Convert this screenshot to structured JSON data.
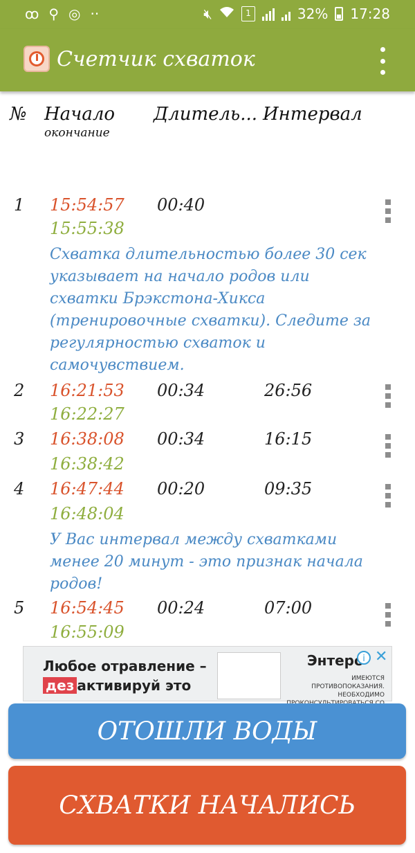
{
  "status_bar": {
    "time": "17:28",
    "battery": "32%",
    "sim": "1"
  },
  "app": {
    "title": "Счетчик схваток"
  },
  "table": {
    "headers": {
      "num": "№",
      "start": "Начало",
      "end": "окончание",
      "duration": "Длитель...",
      "interval": "Интервал"
    },
    "rows": [
      {
        "num": "1",
        "start": "15:54:57",
        "end": "15:55:38",
        "duration": "00:40",
        "interval": "",
        "note": "Схватка длительностью более 30 сек указывает на начало родов или схватки Брэкстона-Хикса (тренировочные схватки). Следите за регулярностью схваток и самочувствием."
      },
      {
        "num": "2",
        "start": "16:21:53",
        "end": "16:22:27",
        "duration": "00:34",
        "interval": "26:56",
        "note": ""
      },
      {
        "num": "3",
        "start": "16:38:08",
        "end": "16:38:42",
        "duration": "00:34",
        "interval": "16:15",
        "note": ""
      },
      {
        "num": "4",
        "start": "16:47:44",
        "end": "16:48:04",
        "duration": "00:20",
        "interval": "09:35",
        "note": "У Вас интервал между схватками менее 20 минут - это признак начала родов!"
      },
      {
        "num": "5",
        "start": "16:54:45",
        "end": "16:55:09",
        "duration": "00:24",
        "interval": "07:00",
        "note": ""
      }
    ]
  },
  "ad": {
    "line1": "Любое отравление –",
    "line2_highlight": "дез",
    "line2_rest": "активируй это",
    "brand": "Энтеро",
    "disclaimer": "ИМЕЮТСЯ ПРОТИВОПОКАЗАНИЯ. НЕОБХОДИМО ПРОКОНСУЛЬТИРОВАТЬСЯ СО СПЕЦИАЛИСТОМ",
    "info_glyph": "i",
    "close_glyph": "✕"
  },
  "buttons": {
    "water": "ОТОШЛИ ВОДЫ",
    "contractions": "СХВАТКИ НАЧАЛИСЬ"
  },
  "colors": {
    "bar": "#8faa3e",
    "start_time": "#d9532c",
    "end_time": "#8fae3f",
    "note": "#4a89c4",
    "btn_water": "#4a91d3",
    "btn_contractions": "#e05a30"
  }
}
